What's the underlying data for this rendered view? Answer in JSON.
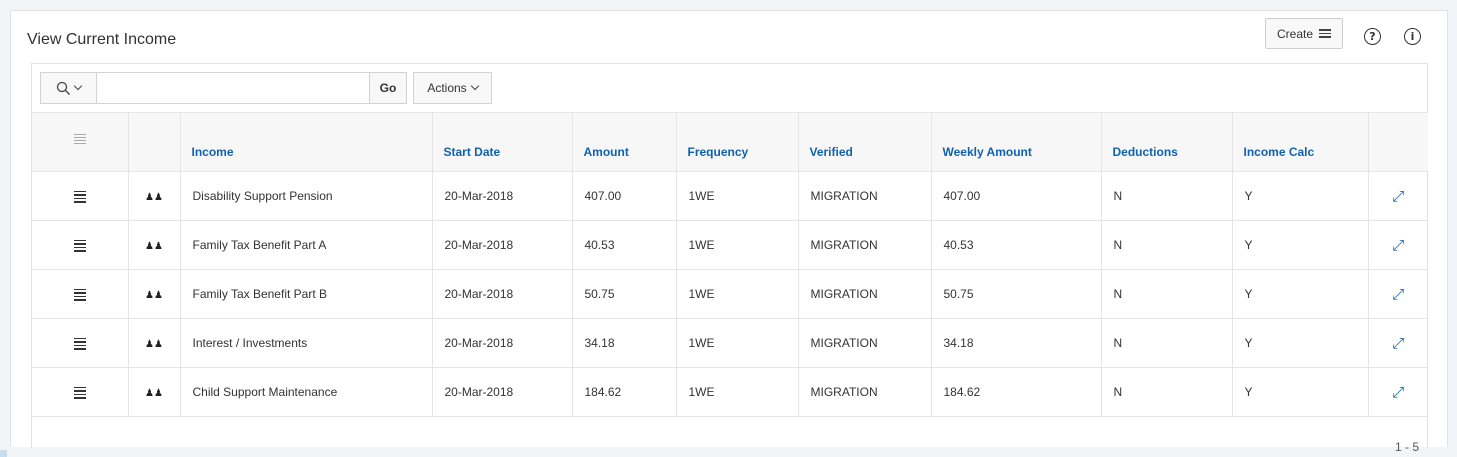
{
  "region": {
    "title": "View Current Income",
    "create_label": "Create",
    "help_glyph": "?",
    "info_glyph": "i"
  },
  "toolbar": {
    "search_icon": "search-icon",
    "search_value": "",
    "go_label": "Go",
    "actions_label": "Actions"
  },
  "table": {
    "columns": [
      "",
      "",
      "Income",
      "Start Date",
      "Amount",
      "Frequency",
      "Verified",
      "Weekly Amount",
      "Deductions",
      "Income Calc",
      ""
    ],
    "rows": [
      {
        "income": "Disability Support Pension",
        "start_date": "20-Mar-2018",
        "amount": "407.00",
        "frequency": "1WE",
        "verified": "MIGRATION",
        "weekly_amount": "407.00",
        "deductions": "N",
        "income_calc": "Y"
      },
      {
        "income": "Family Tax Benefit Part A",
        "start_date": "20-Mar-2018",
        "amount": "40.53",
        "frequency": "1WE",
        "verified": "MIGRATION",
        "weekly_amount": "40.53",
        "deductions": "N",
        "income_calc": "Y"
      },
      {
        "income": "Family Tax Benefit Part B",
        "start_date": "20-Mar-2018",
        "amount": "50.75",
        "frequency": "1WE",
        "verified": "MIGRATION",
        "weekly_amount": "50.75",
        "deductions": "N",
        "income_calc": "Y"
      },
      {
        "income": "Interest / Investments",
        "start_date": "20-Mar-2018",
        "amount": "34.18",
        "frequency": "1WE",
        "verified": "MIGRATION",
        "weekly_amount": "34.18",
        "deductions": "N",
        "income_calc": "Y"
      },
      {
        "income": "Child Support Maintenance",
        "start_date": "20-Mar-2018",
        "amount": "184.62",
        "frequency": "1WE",
        "verified": "MIGRATION",
        "weekly_amount": "184.62",
        "deductions": "N",
        "income_calc": "Y"
      }
    ]
  },
  "pagination": {
    "label": "1 - 5"
  },
  "colors": {
    "link": "#1062b1",
    "header_bg": "#f7f7f7",
    "border": "#e5e5e5"
  },
  "icons": {
    "row_menu": "hamburger-icon",
    "row_person": "people-icon",
    "row_expand": "expand-icon"
  }
}
